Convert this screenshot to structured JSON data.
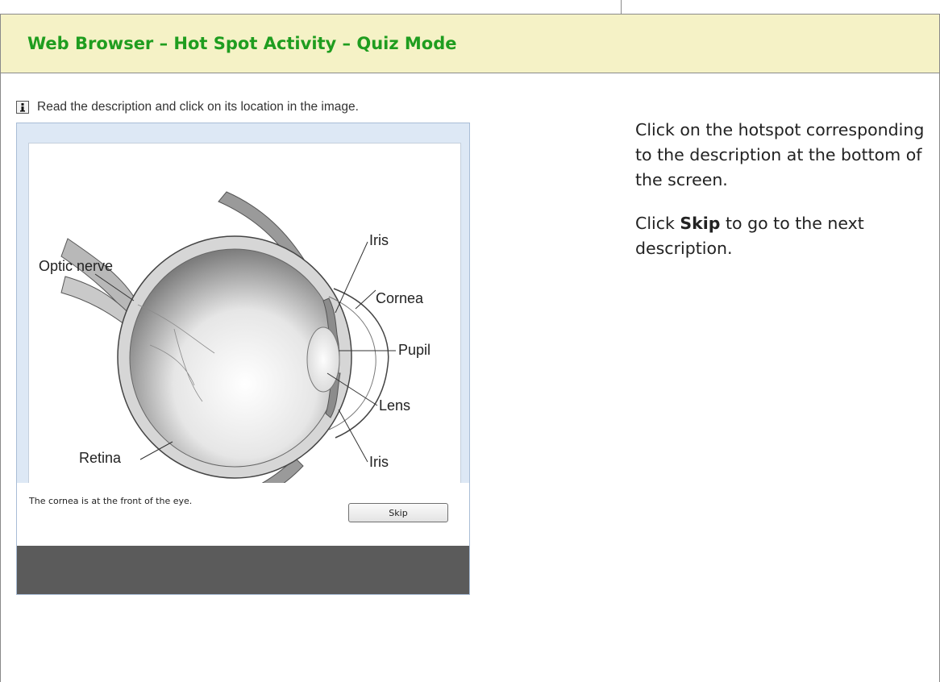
{
  "header": {
    "title": "Web Browser – Hot Spot Activity – Quiz Mode"
  },
  "activity": {
    "instruction": "Read the description and click on its location in the image.",
    "instruction_icon": "info-icon",
    "diagram_labels": {
      "iris_top": "Iris",
      "optic_nerve": "Optic nerve",
      "cornea": "Cornea",
      "pupil": "Pupil",
      "lens": "Lens",
      "retina": "Retina",
      "iris_bottom": "Iris"
    },
    "description": "The cornea is at the front of the eye.",
    "skip_label": "Skip"
  },
  "side": {
    "paragraph1": "Click on the hotspot corresponding to the description at the bottom of the screen.",
    "paragraph2_prefix": "Click ",
    "paragraph2_bold": "Skip",
    "paragraph2_suffix": " to go to the next description."
  },
  "colors": {
    "header_bg": "#f5f2c6",
    "title_green": "#1f9d1f",
    "activity_bg": "#dde8f5",
    "footer_band": "#5b5b5b"
  }
}
